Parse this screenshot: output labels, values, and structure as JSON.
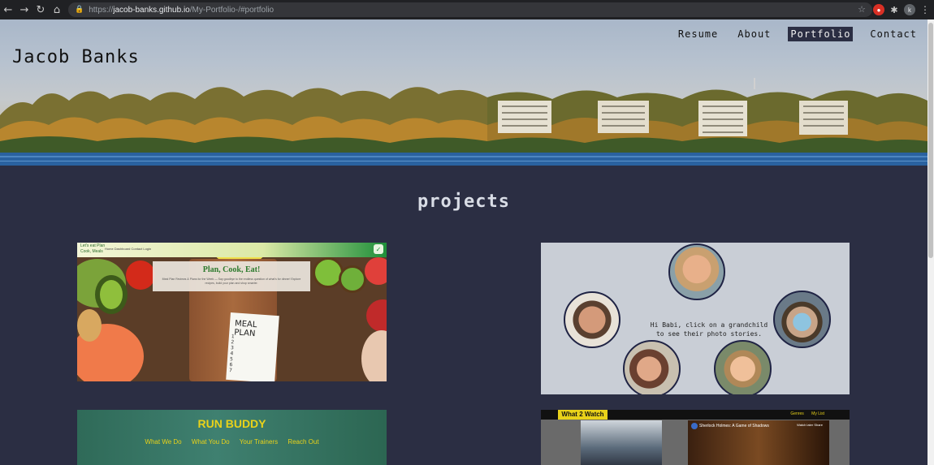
{
  "browser": {
    "url_prefix": "https://",
    "url_host": "jacob-banks.github.io",
    "url_path": "/My-Portfolio-/#portfolio",
    "profile_initial": "k"
  },
  "site": {
    "name": "Jacob Banks",
    "nav": [
      {
        "label": "Resume",
        "active": false
      },
      {
        "label": "About",
        "active": false
      },
      {
        "label": "Portfolio",
        "active": true
      },
      {
        "label": "Contact",
        "active": false
      }
    ]
  },
  "projects": {
    "title": "projects",
    "meal": {
      "brand_line1": "Let's eat Plan",
      "brand_line2": "Cook, Meals",
      "links": "Home  Dashboard  Contact  Login",
      "heading": "Plan, Cook, Eat!",
      "subtext": "Meal Plan Reviews & Plans for the Week — Say goodbye to the endless question of what's for dinner! Explore recipes, build your plan and shop smarter.",
      "paper_title": "MEAL PLAN",
      "paper_numbers": "1\n2\n3\n4\n5\n6\n7"
    },
    "babi": {
      "caption": "Hi Babi, click on a grandchild to see their photo stories."
    },
    "run": {
      "title": "RUN BUDDY",
      "nav": [
        "What We Do",
        "What You Do",
        "Your Trainers",
        "Reach Out"
      ]
    },
    "watch": {
      "logo": "What 2 Watch",
      "links": [
        "Genres",
        "My List"
      ],
      "video_title": "Sherlock Holmes: A Game of Shadows",
      "video_icons": "Watch later   Share"
    }
  }
}
